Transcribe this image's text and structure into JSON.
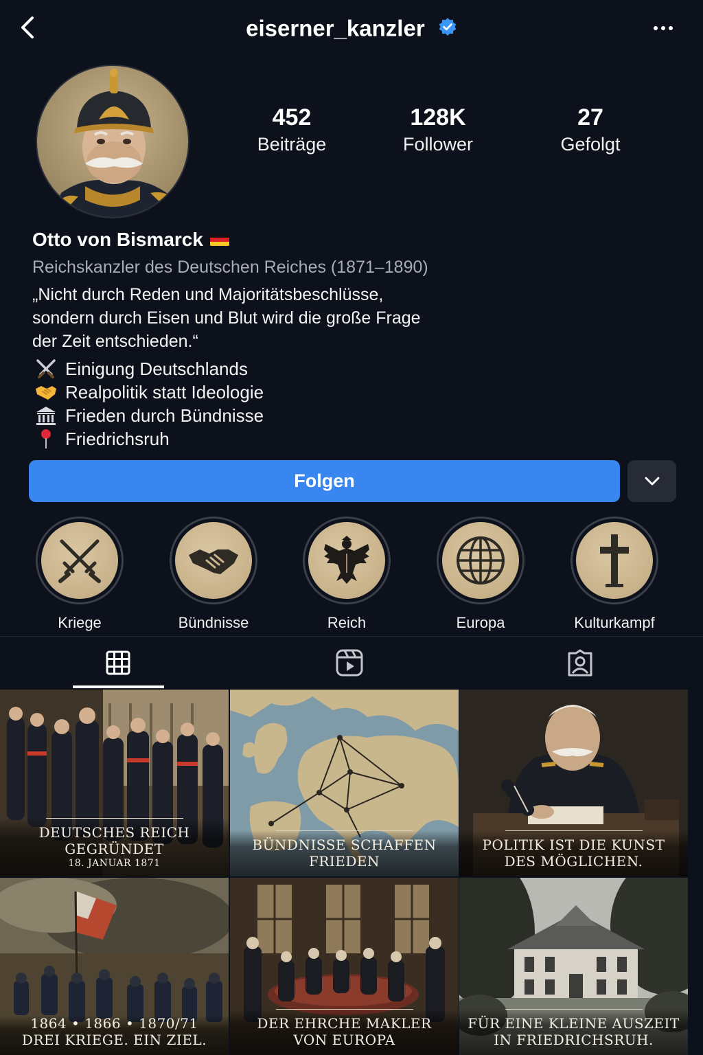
{
  "header": {
    "username": "eiserner_kanzler",
    "verified": true,
    "back_icon": "chevron-left-icon",
    "more_icon": "more-horizontal-icon"
  },
  "profile": {
    "stats": [
      {
        "value": "452",
        "label": "Beiträge"
      },
      {
        "value": "128K",
        "label": "Follower"
      },
      {
        "value": "27",
        "label": "Gefolgt"
      }
    ],
    "name": "Otto von Bismarck",
    "subtitle": "Reichskanzler des Deutschen Reiches (1871–1890)",
    "quote_lines": [
      "„Nicht durch Reden und Majoritätsbeschlüsse,",
      "sondern durch Eisen und Blut wird die große Frage",
      "der Zeit entschieden.“"
    ],
    "bullets": [
      {
        "icon": "crossed-swords-icon",
        "text": "Einigung Deutschlands"
      },
      {
        "icon": "handshake-icon",
        "text": "Realpolitik statt Ideologie"
      },
      {
        "icon": "classical-building-icon",
        "text": "Frieden durch Bündnisse"
      },
      {
        "icon": "pin-icon",
        "text": "Friedrichsruh"
      }
    ]
  },
  "actions": {
    "follow_label": "Folgen",
    "follow_color": "#3a86f0"
  },
  "highlights": [
    {
      "label": "Kriege",
      "icon": "crossed-swords-icon"
    },
    {
      "label": "Bündnisse",
      "icon": "handshake-icon"
    },
    {
      "label": "Reich",
      "icon": "eagle-icon"
    },
    {
      "label": "Europa",
      "icon": "globe-icon"
    },
    {
      "label": "Kulturkampf",
      "icon": "cross-icon"
    }
  ],
  "tabs": [
    {
      "name": "posts",
      "icon": "grid-icon",
      "active": true
    },
    {
      "name": "reels",
      "icon": "reels-icon",
      "active": false
    },
    {
      "name": "tagged",
      "icon": "tagged-user-icon",
      "active": false
    }
  ],
  "posts": [
    {
      "line1": "DEUTSCHES REICH",
      "line2": "GEGRÜNDET",
      "line3": "18. JANUAR 1871"
    },
    {
      "line1": "BÜNDNISSE SCHAFFEN",
      "line2": "FRIEDEN"
    },
    {
      "line1": "POLITIK IST DIE KUNST",
      "line2": "DES MÖGLICHEN."
    },
    {
      "line1": "1864 • 1866 • 1870/71",
      "line2": "DREI KRIEGE. EIN ZIEL."
    },
    {
      "line1": "DER EHRCHE MAKLER",
      "line2": "VON EUROPA"
    },
    {
      "line1": "FÜR EINE KLEINE AUSZEIT",
      "line2": "IN FRIEDRICHSRUH."
    }
  ]
}
